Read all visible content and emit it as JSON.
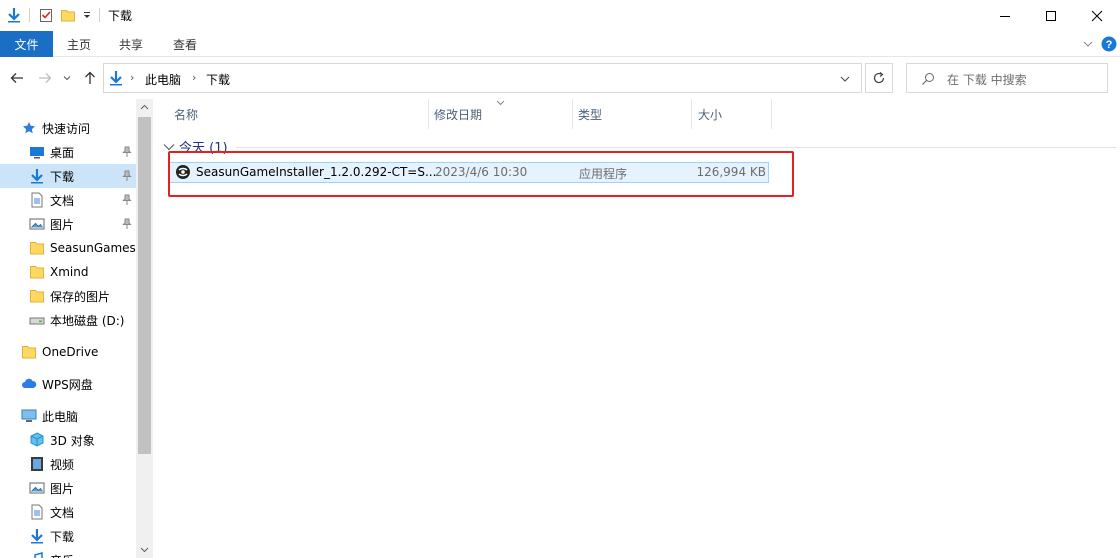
{
  "window": {
    "title": "下载",
    "controls": {
      "minimize": "minimize-icon",
      "maximize": "maximize-icon",
      "close": "close-icon"
    }
  },
  "quick_access_toolbar": [
    "download-icon",
    "properties-icon",
    "new-folder-icon",
    "customize-dropdown-icon"
  ],
  "ribbon": {
    "tabs": [
      {
        "label": "文件",
        "active": true
      },
      {
        "label": "主页",
        "active": false
      },
      {
        "label": "共享",
        "active": false
      },
      {
        "label": "查看",
        "active": false
      }
    ]
  },
  "nav": {
    "breadcrumb": [
      "此电脑",
      "下载"
    ],
    "search_placeholder": "在 下载 中搜索"
  },
  "sidebar": {
    "items": [
      {
        "label": "快速访问",
        "icon": "star-icon",
        "pinned": false
      },
      {
        "label": "桌面",
        "icon": "desktop-icon",
        "pinned": true
      },
      {
        "label": "下载",
        "icon": "download-icon",
        "pinned": true,
        "selected": true
      },
      {
        "label": "文档",
        "icon": "document-icon",
        "pinned": true
      },
      {
        "label": "图片",
        "icon": "picture-icon",
        "pinned": true
      },
      {
        "label": "SeasunGamesL",
        "icon": "folder-icon",
        "pinned": false
      },
      {
        "label": "Xmind",
        "icon": "folder-icon",
        "pinned": false
      },
      {
        "label": "保存的图片",
        "icon": "folder-icon",
        "pinned": false
      },
      {
        "label": "本地磁盘 (D:)",
        "icon": "drive-icon",
        "pinned": false
      },
      {
        "label": "OneDrive",
        "icon": "onedrive-icon",
        "pinned": false
      },
      {
        "label": "WPS网盘",
        "icon": "cloud-icon",
        "pinned": false
      },
      {
        "label": "此电脑",
        "icon": "computer-icon",
        "pinned": false
      },
      {
        "label": "3D 对象",
        "icon": "cube-icon",
        "pinned": false
      },
      {
        "label": "视频",
        "icon": "video-icon",
        "pinned": false
      },
      {
        "label": "图片",
        "icon": "picture-icon",
        "pinned": false
      },
      {
        "label": "文档",
        "icon": "document-icon",
        "pinned": false
      },
      {
        "label": "下载",
        "icon": "download-icon",
        "pinned": false
      },
      {
        "label": "音乐",
        "icon": "music-icon",
        "pinned": false
      }
    ]
  },
  "columns": [
    "名称",
    "修改日期",
    "类型",
    "大小"
  ],
  "group": {
    "label": "今天 (1)"
  },
  "files": [
    {
      "name": "SeasunGameInstaller_1.2.0.292-CT=S...",
      "modified": "2023/4/6 10:30",
      "type": "应用程序",
      "size": "126,994 KB",
      "icon": "installer-icon"
    }
  ],
  "colors": {
    "accent": "#1a6fc4",
    "highlight_box": "#e5201f",
    "selection": "#cce4f7",
    "group_text": "#1e3287"
  }
}
